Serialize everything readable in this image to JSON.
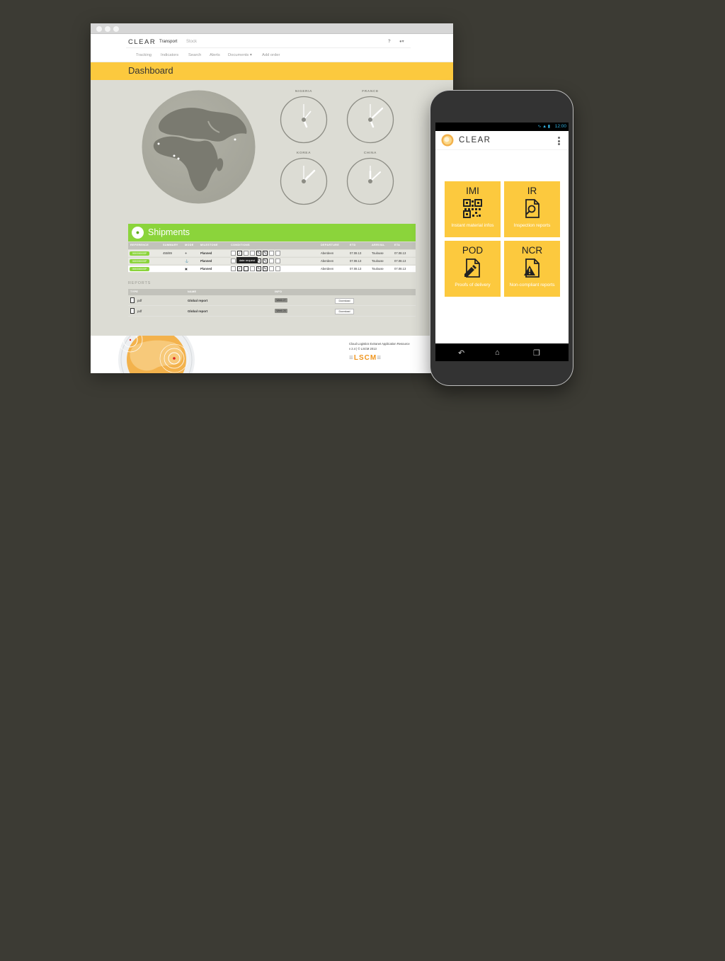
{
  "desktop": {
    "brand": "CLEAR",
    "top_tabs": [
      "Transport",
      "Stock"
    ],
    "sub_nav": [
      "Tracking",
      "Indicators",
      "Search",
      "Alerts",
      "Documents ▾",
      "Add order"
    ],
    "page_title": "Dashboard",
    "clocks": [
      {
        "label": "NIGERIA"
      },
      {
        "label": "FRANCE"
      },
      {
        "label": "KOREA"
      },
      {
        "label": "CHINA"
      }
    ],
    "shipments": {
      "title": "Shipments",
      "columns": [
        "REFERENCE",
        "SUMMARY",
        "MODE",
        "MILESTONE",
        "CONDITIONS",
        "DEPARTURE",
        "ETD",
        "ARRIVAL",
        "ETA"
      ],
      "rows": [
        {
          "reference": "000000000SP",
          "summary": "455/89",
          "milestone": "Planned",
          "departure": "Aberdeen",
          "etd": "07.08.13",
          "arrival": "Toulouse",
          "eta": "07.08.13"
        },
        {
          "reference": "000000000SP",
          "summary": "",
          "milestone": "Planned",
          "departure": "Aberdeen",
          "etd": "07.08.13",
          "arrival": "Toulouse",
          "eta": "07.08.13"
        },
        {
          "reference": "000000000SP",
          "summary": "",
          "milestone": "Planned",
          "departure": "Aberdeen",
          "etd": "07.08.13",
          "arrival": "Toulouse",
          "eta": "07.08.13"
        }
      ],
      "tooltip": "date request"
    },
    "reports": {
      "title": "REPORTS",
      "columns": [
        "TYPE",
        "NAME",
        "INFO"
      ],
      "rows": [
        {
          "type": "pdf",
          "name": "Global report",
          "info": "Week 27",
          "action": "Download"
        },
        {
          "type": "pdf",
          "name": "Global report",
          "info": "Week 26",
          "action": "Download"
        }
      ]
    },
    "footer": {
      "line1": "Cloud Logistics Extranet Application Resource",
      "line2": "v 2.4  |  © LSCM 2013",
      "company": "LSCM"
    }
  },
  "mobile": {
    "status_time": "12:00",
    "app_title": "CLEAR",
    "tiles": [
      {
        "code": "IMI",
        "caption": "Instant material infos",
        "icon": "qr-code-icon"
      },
      {
        "code": "IR",
        "caption": "Inspection reports",
        "icon": "document-search-icon"
      },
      {
        "code": "POD",
        "caption": "Proofs of delivery",
        "icon": "document-edit-icon"
      },
      {
        "code": "NCR",
        "caption": "Non-compliant reports",
        "icon": "document-warning-icon"
      }
    ]
  },
  "colors": {
    "background": "#3c3b34",
    "accent_yellow": "#fcc93e",
    "accent_green": "#8bd43b",
    "brand_orange": "#f0951c"
  }
}
